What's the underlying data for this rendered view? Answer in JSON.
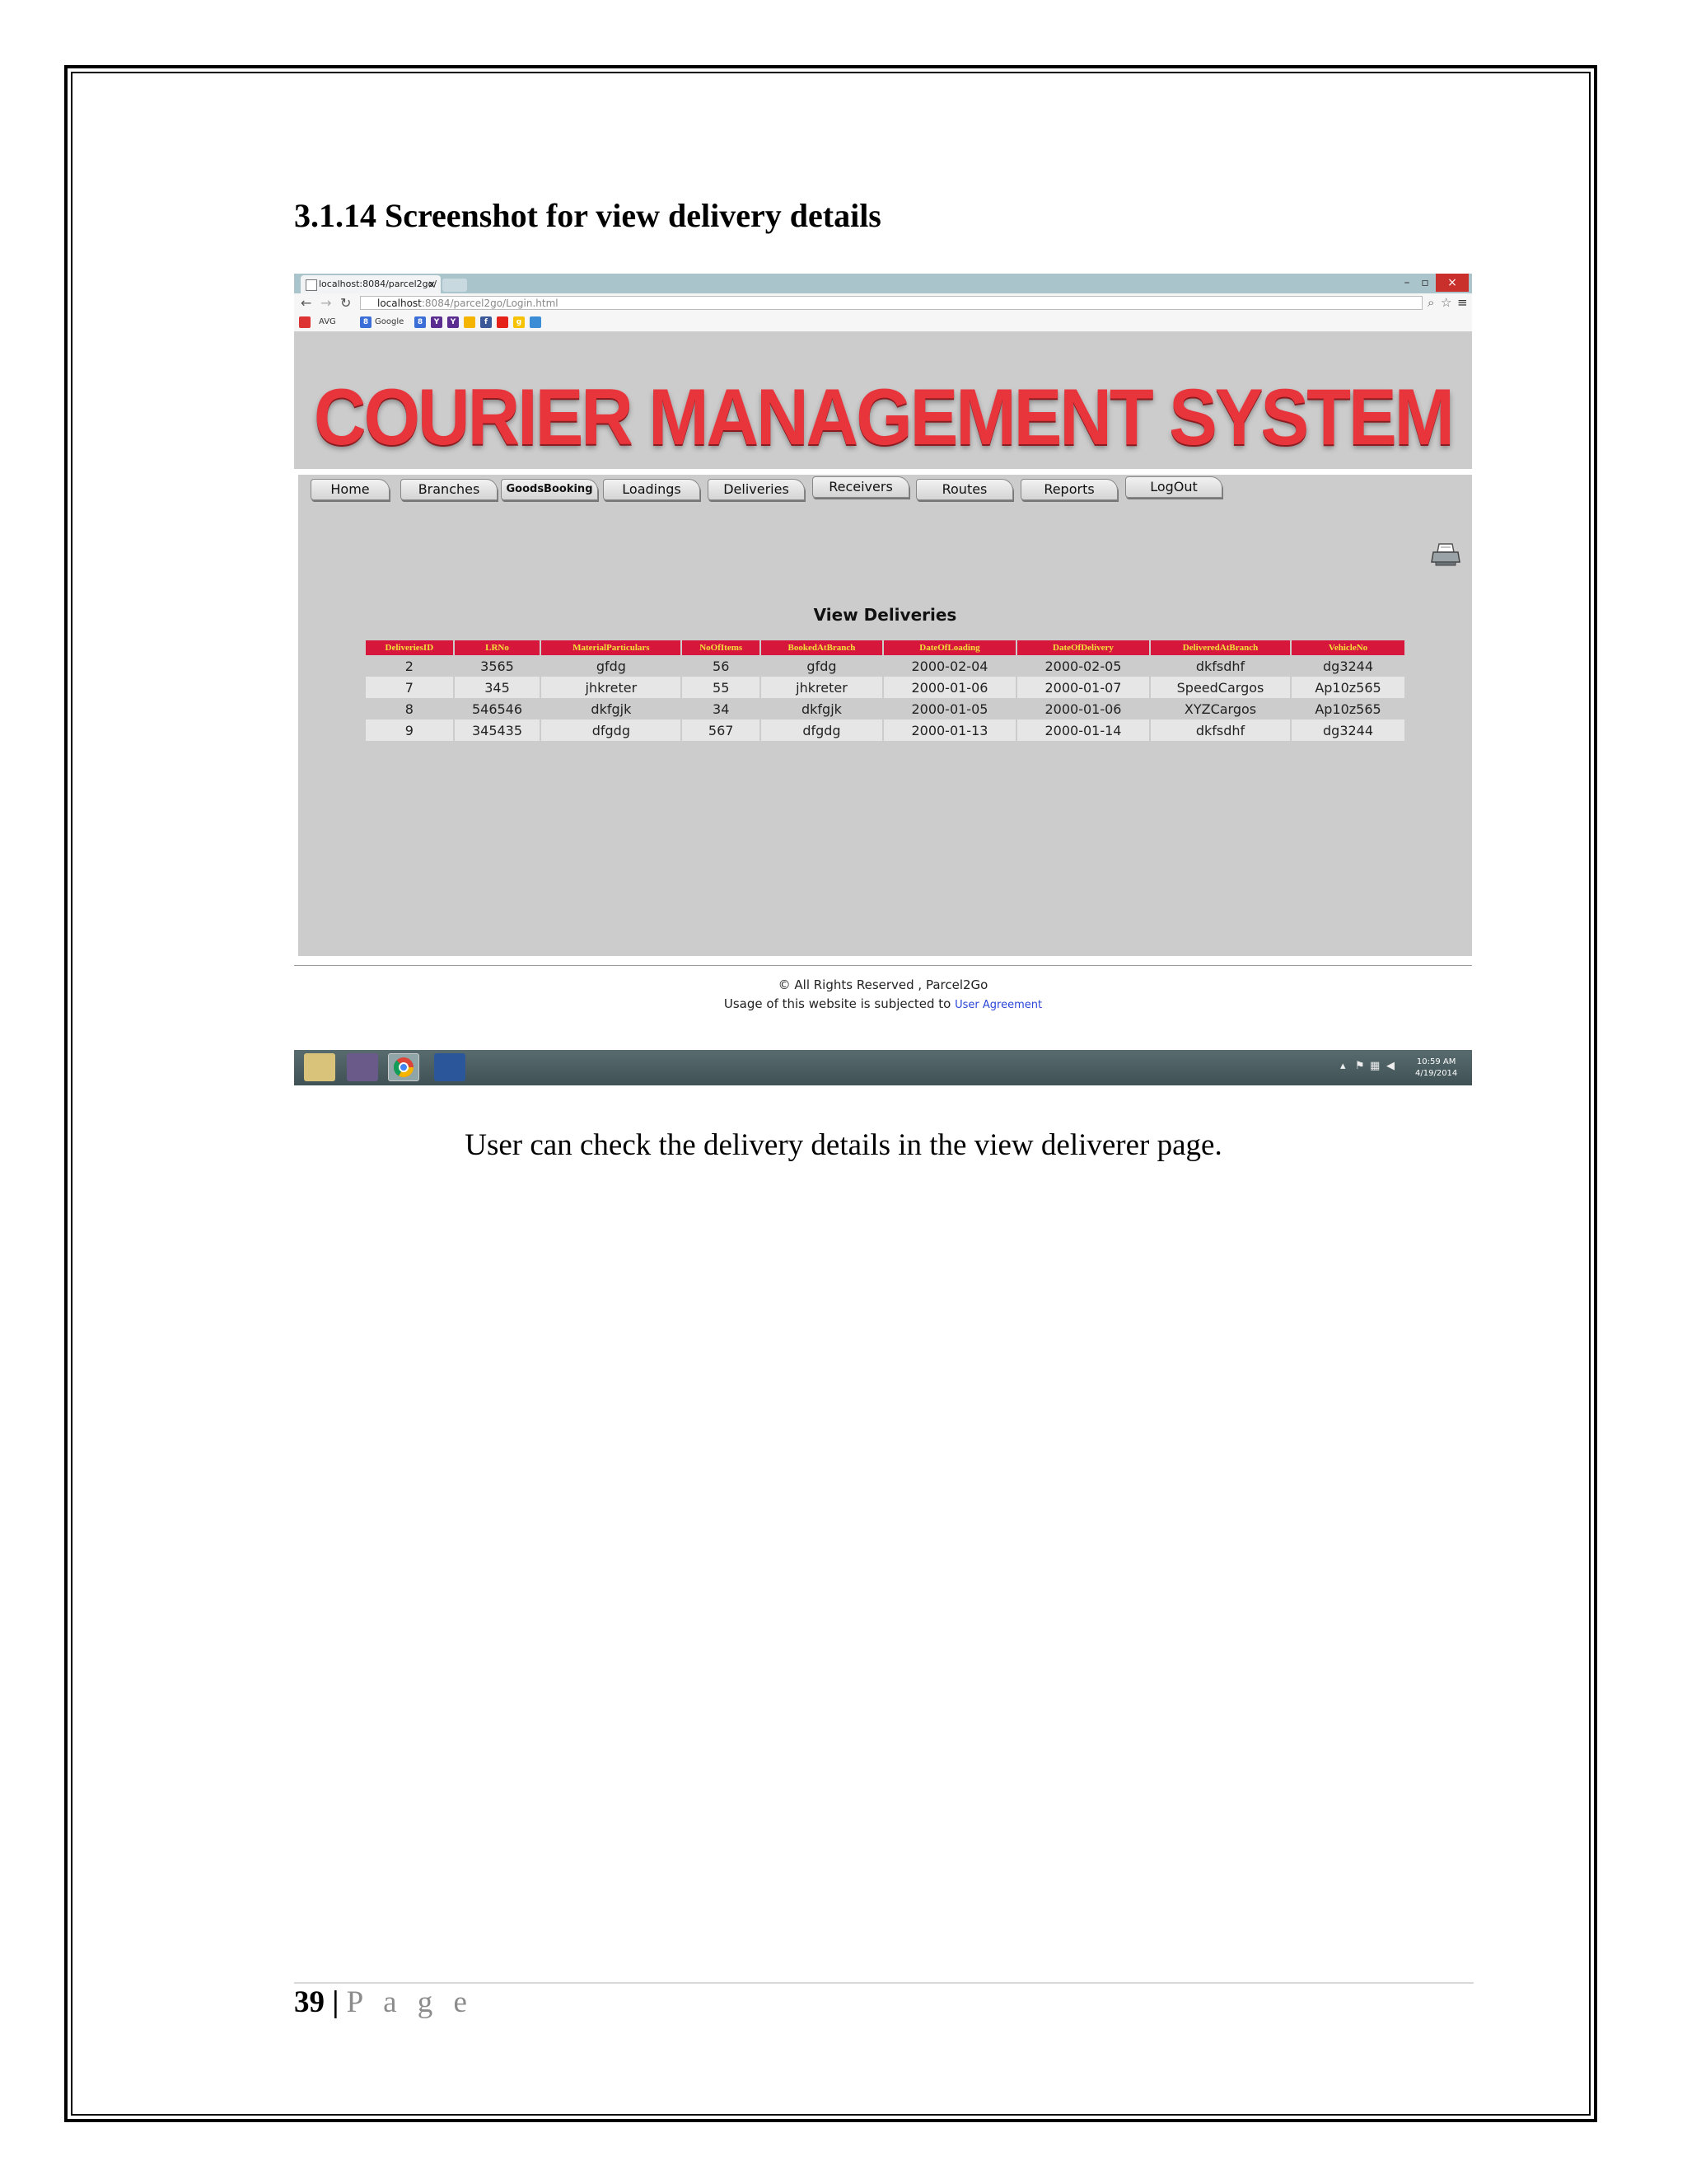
{
  "document": {
    "section_heading": "3.1.14 Screenshot for view delivery details",
    "caption": "User can check the delivery details in the view deliverer page.",
    "page_number": "39",
    "page_separator": "|",
    "page_word": "P a g e"
  },
  "browser": {
    "tab_title": "localhost:8084/parcel2go/",
    "tab_close": "×",
    "url_host": "localhost",
    "url_path": ":8084/parcel2go/Login.html",
    "window_buttons": {
      "minimize": "–",
      "restore": "▫",
      "close": "×"
    },
    "bookmarks": [
      "AVG",
      "Google"
    ]
  },
  "app": {
    "banner_title": "COURIER MANAGEMENT SYSTEM",
    "nav": [
      "Home",
      "Branches",
      "GoodsBooking",
      "Loadings",
      "Deliveries",
      "Receivers",
      "Routes",
      "Reports",
      "LogOut"
    ],
    "table_title": "View Deliveries",
    "columns": [
      "DeliveriesID",
      "LRNo",
      "MaterialParticulars",
      "NoOfItems",
      "BookedAtBranch",
      "DateOfLoading",
      "DateOfDelivery",
      "DeliveredAtBranch",
      "VehicleNo"
    ],
    "rows": [
      [
        "2",
        "3565",
        "gfdg",
        "56",
        "gfdg",
        "2000-02-04",
        "2000-02-05",
        "dkfsdhf",
        "dg3244"
      ],
      [
        "7",
        "345",
        "jhkreter",
        "55",
        "jhkreter",
        "2000-01-06",
        "2000-01-07",
        "SpeedCargos",
        "Ap10z565"
      ],
      [
        "8",
        "546546",
        "dkfgjk",
        "34",
        "dkfgjk",
        "2000-01-05",
        "2000-01-06",
        "XYZCargos",
        "Ap10z565"
      ],
      [
        "9",
        "345435",
        "dfgdg",
        "567",
        "dfgdg",
        "2000-01-13",
        "2000-01-14",
        "dkfsdhf",
        "dg3244"
      ]
    ],
    "footer_line1": "© All Rights Reserved , Parcel2Go",
    "footer_line2": "Usage of this website is subjected to",
    "footer_link": "User Agreement"
  },
  "taskbar": {
    "clock_time": "10:59 AM",
    "clock_date": "4/19/2014"
  },
  "colors": {
    "banner_text": "#e8353c",
    "table_header_bg": "#d6163a",
    "table_header_text": "#f3e13a",
    "panel_bg": "#cccccc"
  }
}
